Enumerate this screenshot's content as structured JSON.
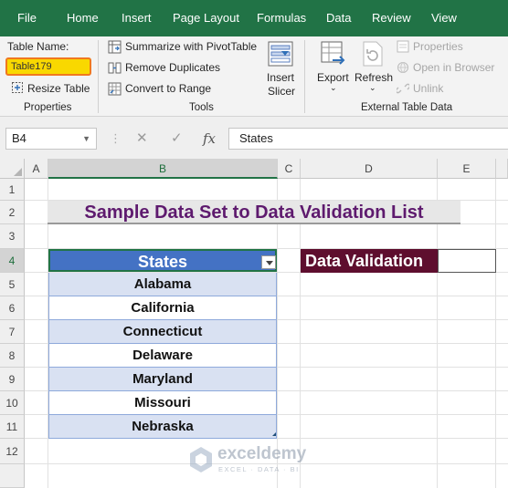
{
  "menu": [
    "File",
    "Home",
    "Insert",
    "Page Layout",
    "Formulas",
    "Data",
    "Review",
    "View"
  ],
  "ribbon": {
    "properties": {
      "table_name_label": "Table Name:",
      "table_name_value": "Table179",
      "resize_label": "Resize Table",
      "group_label": "Properties"
    },
    "tools": {
      "summarize_label": "Summarize with PivotTable",
      "remove_duplicates_label": "Remove Duplicates",
      "convert_label": "Convert to Range",
      "insert_slicer_line1": "Insert",
      "insert_slicer_line2": "Slicer",
      "group_label": "Tools"
    },
    "external": {
      "export_label": "Export",
      "refresh_label": "Refresh",
      "properties_label": "Properties",
      "open_browser_label": "Open in Browser",
      "unlink_label": "Unlink",
      "group_label": "External Table Data"
    }
  },
  "formula_bar": {
    "name_box": "B4",
    "fx_symbols": [
      "✕",
      "✓",
      "fx"
    ],
    "formula": "States"
  },
  "columns": [
    "A",
    "B",
    "C",
    "D",
    "E"
  ],
  "rows": [
    "1",
    "2",
    "3",
    "4",
    "5",
    "6",
    "7",
    "8",
    "9",
    "10",
    "11",
    "12"
  ],
  "sheet": {
    "title": "Sample Data Set to Data Validation List",
    "table_header": "States",
    "states": [
      "Alabama",
      "California",
      "Connecticut",
      "Delaware",
      "Maryland",
      "Missouri",
      "Nebraska"
    ],
    "dv_label": "Data Validation"
  },
  "watermark": {
    "name": "exceldemy",
    "tagline": "EXCEL · DATA · BI"
  },
  "colors": {
    "excel_green": "#217346",
    "table_header_blue": "#4472c4",
    "table_band": "#d9e1f2",
    "title_purple": "#5e1a6e",
    "dv_maroon": "#5e0e2e",
    "table_name_highlight": "#f9d800"
  }
}
